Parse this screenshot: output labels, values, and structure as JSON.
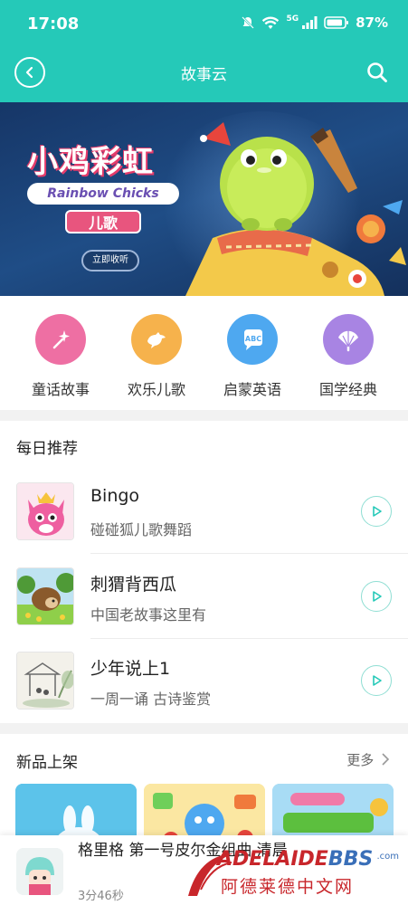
{
  "status_bar": {
    "time": "17:08",
    "network": "5G",
    "battery": "87%"
  },
  "navbar": {
    "title": "故事云"
  },
  "banner": {
    "logo_title": "小鸡彩虹",
    "logo_en": "Rainbow Chicks",
    "logo_tag": "儿歌",
    "listen_button": "立即收听"
  },
  "categories": [
    {
      "label": "童话故事",
      "icon": "magic-wand-icon",
      "color": "#ee6fa3"
    },
    {
      "label": "欢乐儿歌",
      "icon": "bird-icon",
      "color": "#f6b24c"
    },
    {
      "label": "启蒙英语",
      "icon": "abc-icon",
      "color": "#4ea8f0"
    },
    {
      "label": "国学经典",
      "icon": "fan-icon",
      "color": "#a884e3"
    }
  ],
  "daily": {
    "title": "每日推荐",
    "items": [
      {
        "title": "Bingo",
        "subtitle": "碰碰狐儿歌舞蹈"
      },
      {
        "title": "刺猬背西瓜",
        "subtitle": "中国老故事这里有"
      },
      {
        "title": "少年说上1",
        "subtitle": "一周一诵 古诗鉴赏"
      }
    ]
  },
  "new_arrivals": {
    "title": "新品上架",
    "more": "更多"
  },
  "player": {
    "title": "格里格 第一号皮尔金组曲 清晨",
    "duration": "3分46秒"
  },
  "watermark": {
    "en_red": "ADELAIDE",
    "en_blue": "BBS",
    "dotcom": ".com",
    "cn": "阿德莱德中文网"
  },
  "colors": {
    "header": "#25c9b8",
    "play_ring": "#8fded3",
    "play_arrow": "#25c9b8"
  }
}
